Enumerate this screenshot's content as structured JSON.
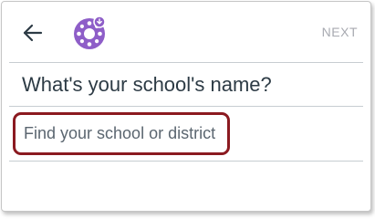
{
  "header": {
    "next_label": "NEXT",
    "back_icon": "back-arrow-icon",
    "logo_icon": "canvas-logo-icon"
  },
  "main": {
    "question": "What's your school's name?",
    "search": {
      "placeholder": "Find your school or district",
      "value": ""
    }
  },
  "colors": {
    "brand": "#8e5ec8",
    "focus_border": "#8b1a20",
    "next_disabled": "#a8aab1",
    "text": "#2d3b45"
  }
}
